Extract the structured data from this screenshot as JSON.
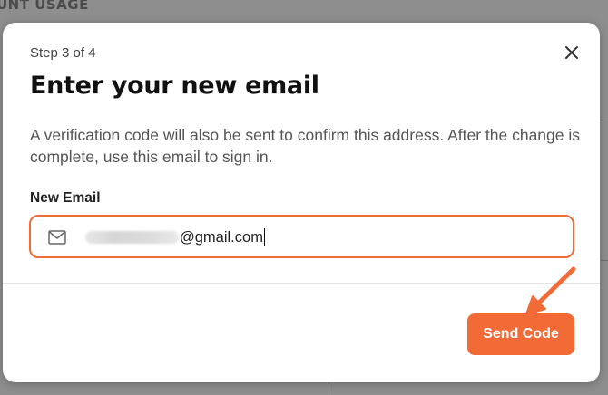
{
  "background": {
    "header_text": "UNT USAGE"
  },
  "modal": {
    "step": "Step 3 of 4",
    "title": "Enter your new email",
    "description": "A verification code will also be sent to confirm this address. After the change is complete, use this email to sign in.",
    "field": {
      "label": "New Email",
      "value_visible": "@gmail.com",
      "icon": "mail-icon"
    },
    "close_icon": "close-icon",
    "send_button_label": "Send Code"
  },
  "colors": {
    "accent": "#f26a35",
    "title": "#111111",
    "text_secondary": "#555555",
    "overlay": "#8f8f8f"
  }
}
